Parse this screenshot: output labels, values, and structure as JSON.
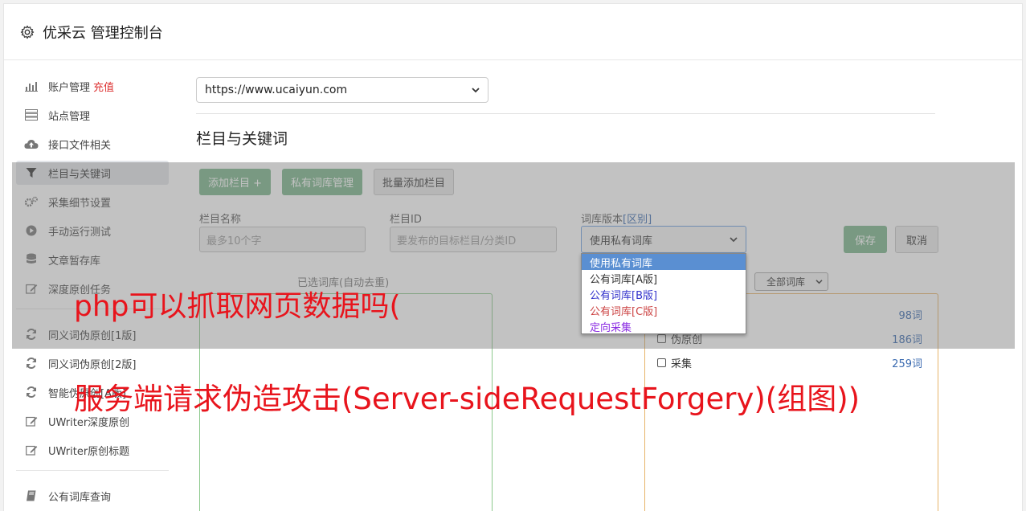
{
  "header": {
    "title": "优采云 管理控制台"
  },
  "sidebar": {
    "items": [
      {
        "label": "账户管理",
        "icon": "bar-chart-icon",
        "extra": "充值"
      },
      {
        "label": "站点管理",
        "icon": "server-icon"
      },
      {
        "label": "接口文件相关",
        "icon": "cloud-upload-icon"
      },
      {
        "label": "栏目与关键词",
        "icon": "filter-icon",
        "active": true
      },
      {
        "label": "采集细节设置",
        "icon": "gears-icon"
      },
      {
        "label": "手动运行测试",
        "icon": "play-circle-icon"
      },
      {
        "label": "文章暂存库",
        "icon": "database-icon"
      },
      {
        "label": "深度原创任务",
        "icon": "edit-icon"
      },
      {
        "label": "同义词伪原创[1版]",
        "icon": "refresh-icon"
      },
      {
        "label": "同义词伪原创[2版]",
        "icon": "refresh-icon"
      },
      {
        "label": "智能伪原创[A版]",
        "icon": "refresh-icon"
      },
      {
        "label": "UWriter深度原创",
        "icon": "edit-icon"
      },
      {
        "label": "UWriter原创标题",
        "icon": "edit-icon"
      },
      {
        "label": "公有词库查询",
        "icon": "book-icon"
      }
    ]
  },
  "main": {
    "site_select": "https://www.ucaiyun.com",
    "section_title": "栏目与关键词",
    "buttons": {
      "add_column": "添加栏目 +",
      "private_lib": "私有词库管理",
      "batch_add": "批量添加栏目"
    },
    "form": {
      "name_label": "栏目名称",
      "name_placeholder": "最多10个字",
      "id_label": "栏目ID",
      "id_placeholder": "要发布的目标栏目/分类ID",
      "version_label": "词库版本",
      "version_link": "[区别]",
      "version_value": "使用私有词库",
      "save": "保存",
      "cancel": "取消"
    },
    "version_options": [
      {
        "label": "使用私有词库",
        "color": "#ffffff",
        "selected": true
      },
      {
        "label": "公有词库[A版]",
        "color": "#333333"
      },
      {
        "label": "公有词库[B版]",
        "color": "#3333cc"
      },
      {
        "label": "公有词库[C版]",
        "color": "#cc4444"
      },
      {
        "label": "定向采集",
        "color": "#8a2be2"
      }
    ],
    "selected_title": "已选词库(自动去重)",
    "lib_filter": "全部词库",
    "libraries": [
      {
        "name": "",
        "count": "98词"
      },
      {
        "name": "伪原创",
        "count": "186词"
      },
      {
        "name": "采集",
        "count": "259词"
      }
    ]
  },
  "overlay_text": {
    "line1": "php可以抓取网页数据吗(",
    "line2": "服务端请求伪造攻击(Server-sideRequestForgery)(组图))"
  }
}
